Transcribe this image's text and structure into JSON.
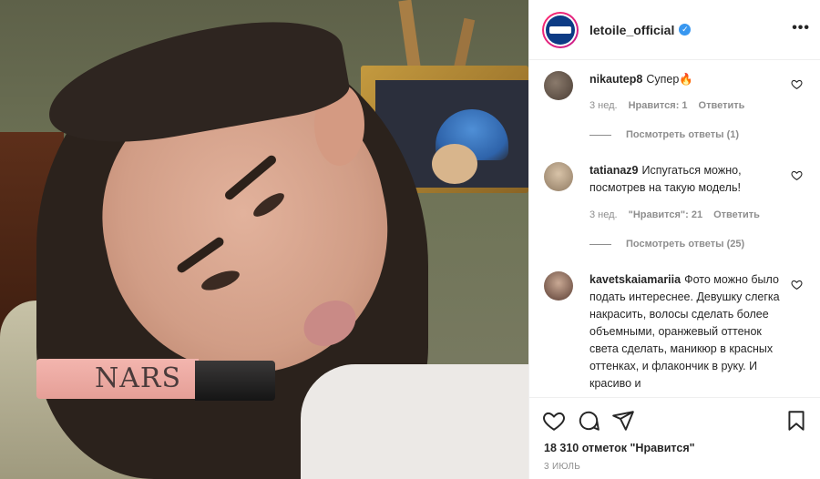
{
  "post": {
    "username": "letoile_official",
    "more_label": "•••",
    "photo_brand_text": "NARS"
  },
  "comments": [
    {
      "username": "nikautep8",
      "text": "Супер🔥",
      "time": "3 нед.",
      "likes": "Нравится: 1",
      "reply": "Ответить",
      "view_replies": "Посмотреть ответы (1)"
    },
    {
      "username": "tatianaz9",
      "text": "Испугаться можно, посмотрев на такую модель!",
      "time": "3 нед.",
      "likes": "\"Нравится\": 21",
      "reply": "Ответить",
      "view_replies": "Посмотреть ответы (25)"
    },
    {
      "username": "kavetskaiamariia",
      "text": "Фото можно было подать интереснее. Девушку слегка накрасить, волосы сделать более объемными, оранжевый оттенок света сделать, маникюр в красных оттенках, и флакончик в руку. И красиво и"
    }
  ],
  "footer": {
    "likes_count": "18 310 отметок \"Нравится\"",
    "date": "3 ИЮЛЬ"
  },
  "icons": [
    "verified-badge-icon",
    "heart-icon",
    "comment-icon",
    "share-icon",
    "bookmark-icon",
    "more-icon"
  ],
  "colors": {
    "verified": "#3897f0",
    "secondary_text": "#8e8e8e",
    "border": "#efefef"
  }
}
